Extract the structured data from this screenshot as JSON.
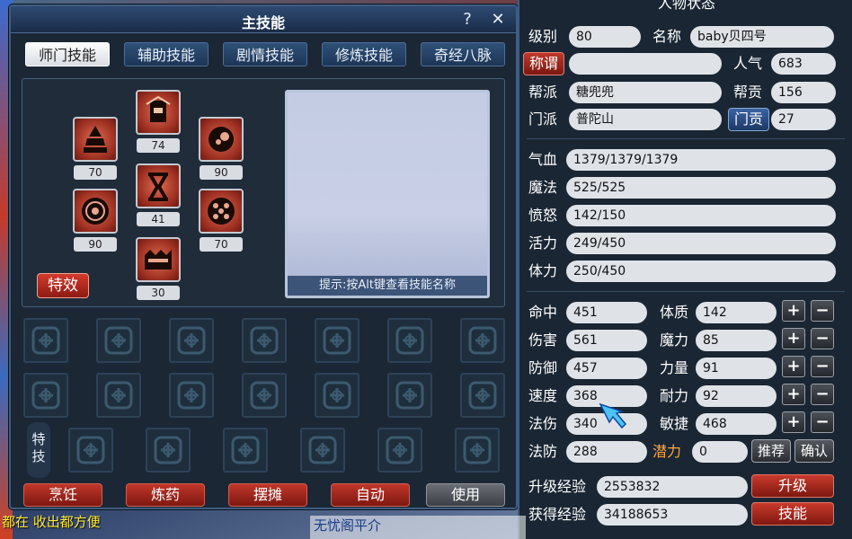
{
  "skill_window": {
    "title": "主技能",
    "help_label": "?",
    "close_label": "✕",
    "tabs": [
      "师门技能",
      "辅助技能",
      "剧情技能",
      "修炼技能",
      "奇经八脉"
    ],
    "skill_levels": [
      "74",
      "70",
      "90",
      "41",
      "90",
      "70",
      "30"
    ],
    "effect_label": "特效",
    "hint": "提示:按Alt键查看技能名称",
    "special_label": "特技",
    "buttons": [
      "烹饪",
      "炼药",
      "摆摊",
      "自动",
      "使用"
    ]
  },
  "status": {
    "title": "人物状态",
    "level_label": "级别",
    "level": "80",
    "name_label": "名称",
    "name": "baby贝四号",
    "title_btn": "称谓",
    "title_value": "",
    "popularity_label": "人气",
    "popularity": "683",
    "faction_label": "帮派",
    "faction": "糖兜兜",
    "contribution_label": "帮贡",
    "contribution": "156",
    "school_label": "门派",
    "school": "普陀山",
    "school_contrib_btn": "门贡",
    "school_contrib": "27",
    "hp_label": "气血",
    "hp": "1379/1379/1379",
    "mp_label": "魔法",
    "mp": "525/525",
    "rage_label": "愤怒",
    "rage": "142/150",
    "vitality_label": "活力",
    "vitality": "249/450",
    "stamina_label": "体力",
    "stamina": "250/450",
    "stats_left": [
      {
        "label": "命中",
        "value": "451"
      },
      {
        "label": "伤害",
        "value": "561"
      },
      {
        "label": "防御",
        "value": "457"
      },
      {
        "label": "速度",
        "value": "368"
      },
      {
        "label": "法伤",
        "value": "340"
      },
      {
        "label": "法防",
        "value": "288"
      }
    ],
    "stats_right": [
      {
        "label": "体质",
        "value": "142"
      },
      {
        "label": "魔力",
        "value": "85"
      },
      {
        "label": "力量",
        "value": "91"
      },
      {
        "label": "耐力",
        "value": "92"
      },
      {
        "label": "敏捷",
        "value": "468"
      }
    ],
    "potential_label": "潜力",
    "potential": "0",
    "recommend_btn": "推荐",
    "confirm_btn": "确认",
    "plus": "+",
    "minus": "−",
    "upgrade_exp_label": "升级经验",
    "upgrade_exp": "2553832",
    "upgrade_btn": "升级",
    "earned_exp_label": "获得经验",
    "earned_exp": "34188653",
    "skill_btn": "技能"
  },
  "chat": {
    "line": "都在 收出都方便",
    "names": "无忧阁平介"
  },
  "colors": {
    "accent_red": "#c0362a",
    "panel_bg": "#1a2633",
    "potential_orange": "#ffa43a"
  }
}
